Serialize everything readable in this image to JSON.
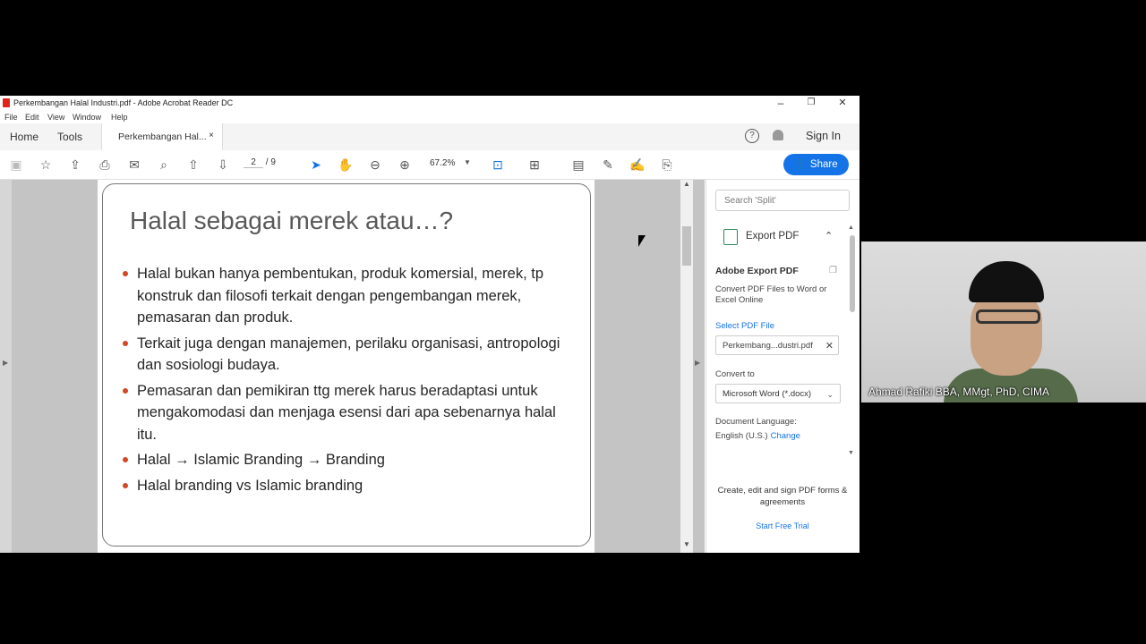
{
  "window": {
    "title": "Perkembangan Halal Industri.pdf - Adobe Acrobat Reader DC",
    "controls": {
      "minimize": "–",
      "restore": "❐",
      "close": "✕"
    }
  },
  "menu": [
    "File",
    "Edit",
    "View",
    "Window",
    "Help"
  ],
  "tabs": {
    "home": "Home",
    "tools": "Tools",
    "document": "Perkembangan Hal...",
    "close": "×",
    "help": "?",
    "sign_in": "Sign In"
  },
  "toolbar": {
    "icons": [
      "save-icon",
      "star-icon",
      "upload-icon",
      "print-icon",
      "mail-icon",
      "search-icon",
      "page-up-icon",
      "page-down-icon",
      "select-icon",
      "hand-icon",
      "zoom-out-icon",
      "zoom-in-icon",
      "fit-page-icon",
      "scroll-mode-icon",
      "comment-icon",
      "pen-icon",
      "sign-icon",
      "fill-sign-icon"
    ],
    "page_current": "2",
    "page_total": "/ 9",
    "zoom": "67.2%",
    "share": "Share"
  },
  "slide": {
    "title": "Halal sebagai merek atau…?",
    "bullets": [
      "Halal bukan hanya pembentukan, produk komersial, merek, tp konstruk dan filosofi terkait dengan pengembangan merek, pemasaran dan produk.",
      "Terkait juga dengan manajemen, perilaku organisasi, antropologi dan sosiologi budaya.",
      "Pemasaran dan pemikiran ttg merek harus beradaptasi untuk mengakomodasi dan menjaga esensi dari apa sebenarnya halal itu.",
      "Halal → Islamic Branding → Branding",
      "Halal branding vs Islamic branding"
    ]
  },
  "panel": {
    "search_placeholder": "Search 'Split'",
    "export_label": "Export PDF",
    "heading": "Adobe Export PDF",
    "description": "Convert PDF Files to Word or Excel Online",
    "select_file": "Select PDF File",
    "file_name": "Perkembang...dustri.pdf",
    "convert_to": "Convert to",
    "format": "Microsoft Word (*.docx)",
    "doc_language": "Document Language:",
    "language": "English (U.S.)",
    "change": "Change",
    "promo": "Create, edit and sign PDF forms & agreements",
    "trial": "Start Free Trial"
  },
  "video": {
    "participant_name": "Ahmad Rafiki BBA, MMgt, PhD, CIMA"
  }
}
